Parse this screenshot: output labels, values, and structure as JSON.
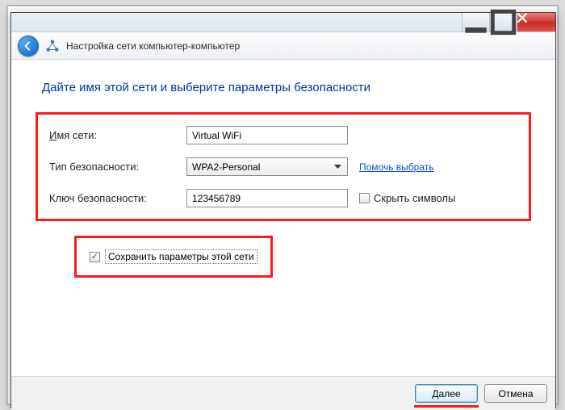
{
  "backdrop": {
    "t1": "",
    "t2": ""
  },
  "window": {
    "title": "Настройка сети компьютер-компьютер",
    "ghost": "",
    "heading": "Дайте имя этой сети и выберите параметры безопасности"
  },
  "form": {
    "name_label_u": "И",
    "name_label_rest": "мя сети:",
    "name_value": "Virtual WiFi",
    "sec_label": "Тип безопасности:",
    "sec_value": "WPA2-Personal",
    "help_link": "Помочь выбрать",
    "key_label": "Ключ безопасности:",
    "key_value": "123456789",
    "hide_label": "Скрыть символы",
    "save_label": "Сохранить параметры этой сети"
  },
  "footer": {
    "next_u": "Д",
    "next_rest": "алее",
    "cancel": "Отмена"
  }
}
